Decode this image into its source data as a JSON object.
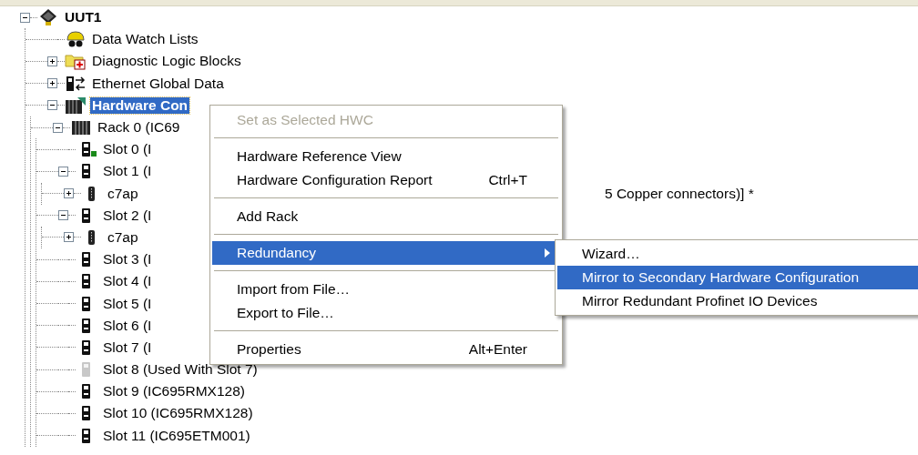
{
  "tree": [
    {
      "label": "UUT1",
      "kind": "target",
      "expanded": true,
      "bold": true,
      "selected": false,
      "children": [
        {
          "label": "Data Watch Lists",
          "kind": "watch",
          "bold": false,
          "selected": false
        },
        {
          "label": "Diagnostic Logic Blocks",
          "kind": "folder",
          "expanded": false,
          "bold": false,
          "selected": false
        },
        {
          "label": "Ethernet Global Data",
          "kind": "ethernet",
          "expanded": false,
          "bold": false,
          "selected": false
        },
        {
          "label": "Hardware Con",
          "kind": "hwconfig",
          "expanded": true,
          "bold": true,
          "selected": true,
          "children": [
            {
              "label": "Rack 0 (IC69",
              "kind": "rack",
              "expanded": true,
              "bold": false,
              "selected": false,
              "children": [
                {
                  "label": "Slot 0 (I",
                  "kind": "cpu",
                  "bold": false,
                  "selected": false
                },
                {
                  "label": "Slot 1 (I",
                  "kind": "module",
                  "expanded": true,
                  "bold": false,
                  "selected": false,
                  "children": [
                    {
                      "label": "c7ap",
                      "tail": "5 Copper connectors)] *",
                      "kind": "port",
                      "expanded": false,
                      "bold": false,
                      "selected": false
                    }
                  ]
                },
                {
                  "label": "Slot 2 (I",
                  "kind": "module",
                  "expanded": true,
                  "bold": false,
                  "selected": false,
                  "children": [
                    {
                      "label": "c7ap",
                      "kind": "port",
                      "expanded": false,
                      "bold": false,
                      "selected": false
                    }
                  ]
                },
                {
                  "label": "Slot 3 (I",
                  "kind": "module",
                  "bold": false,
                  "selected": false
                },
                {
                  "label": "Slot 4 (I",
                  "kind": "module",
                  "bold": false,
                  "selected": false
                },
                {
                  "label": "Slot 5 (I",
                  "kind": "module",
                  "bold": false,
                  "selected": false
                },
                {
                  "label": "Slot 6 (I",
                  "kind": "module",
                  "bold": false,
                  "selected": false
                },
                {
                  "label": "Slot 7 (I",
                  "kind": "module",
                  "bold": false,
                  "selected": false
                },
                {
                  "label": "Slot 8 (Used With Slot 7)",
                  "kind": "module-empty",
                  "bold": false,
                  "selected": false
                },
                {
                  "label": "Slot 9 (IC695RMX128)",
                  "kind": "module",
                  "bold": false,
                  "selected": false
                },
                {
                  "label": "Slot 10 (IC695RMX128)",
                  "kind": "module",
                  "bold": false,
                  "selected": false
                },
                {
                  "label": "Slot 11 (IC695ETM001)",
                  "kind": "module",
                  "bold": false,
                  "selected": false
                }
              ]
            }
          ]
        }
      ]
    }
  ],
  "context_menu": {
    "items": [
      {
        "kind": "item",
        "label": "Set as Selected HWC",
        "disabled": true,
        "selected": false,
        "submenu": false
      },
      {
        "kind": "separator"
      },
      {
        "kind": "item",
        "label": "Hardware Reference View",
        "disabled": false,
        "selected": false,
        "submenu": false
      },
      {
        "kind": "item",
        "label": "Hardware Configuration Report",
        "shortcut": "Ctrl+T",
        "disabled": false,
        "selected": false,
        "submenu": false
      },
      {
        "kind": "separator"
      },
      {
        "kind": "item",
        "label": "Add Rack",
        "disabled": false,
        "selected": false,
        "submenu": false
      },
      {
        "kind": "separator"
      },
      {
        "kind": "item",
        "label": "Redundancy",
        "disabled": false,
        "selected": true,
        "submenu": true
      },
      {
        "kind": "separator"
      },
      {
        "kind": "item",
        "label": "Import from File…",
        "disabled": false,
        "selected": false,
        "submenu": false
      },
      {
        "kind": "item",
        "label": "Export to File…",
        "disabled": false,
        "selected": false,
        "submenu": false
      },
      {
        "kind": "separator"
      },
      {
        "kind": "item",
        "label": "Properties",
        "shortcut": "Alt+Enter",
        "disabled": false,
        "selected": false,
        "submenu": false
      }
    ]
  },
  "submenu": {
    "items": [
      {
        "label": "Wizard…",
        "selected": false
      },
      {
        "label": "Mirror to Secondary Hardware Configuration",
        "selected": true
      },
      {
        "label": "Mirror Redundant Profinet IO Devices",
        "selected": false
      }
    ]
  }
}
